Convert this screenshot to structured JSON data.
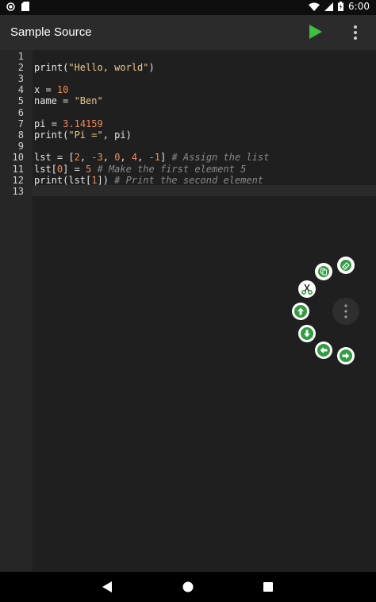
{
  "status": {
    "time": "6:00"
  },
  "app": {
    "title": "Sample Source"
  },
  "editor": {
    "line_numbers": [
      "1",
      "2",
      "3",
      "4",
      "5",
      "6",
      "7",
      "8",
      "9",
      "10",
      "11",
      "12",
      "13"
    ],
    "lines": [
      [],
      [
        {
          "t": "print(",
          "c": ""
        },
        {
          "t": "\"Hello, world\"",
          "c": "str"
        },
        {
          "t": ")",
          "c": ""
        }
      ],
      [],
      [
        {
          "t": "x ",
          "c": ""
        },
        {
          "t": "= ",
          "c": "op"
        },
        {
          "t": "10",
          "c": "num"
        }
      ],
      [
        {
          "t": "name ",
          "c": ""
        },
        {
          "t": "= ",
          "c": "op"
        },
        {
          "t": "\"Ben\"",
          "c": "str"
        }
      ],
      [],
      [
        {
          "t": "pi ",
          "c": ""
        },
        {
          "t": "= ",
          "c": "op"
        },
        {
          "t": "3.14159",
          "c": "num"
        }
      ],
      [
        {
          "t": "print(",
          "c": ""
        },
        {
          "t": "\"Pi =\"",
          "c": "str"
        },
        {
          "t": ", pi)",
          "c": ""
        }
      ],
      [],
      [
        {
          "t": "lst ",
          "c": ""
        },
        {
          "t": "= ",
          "c": "op"
        },
        {
          "t": "[",
          "c": ""
        },
        {
          "t": "2",
          "c": "num"
        },
        {
          "t": ", ",
          "c": ""
        },
        {
          "t": "-3",
          "c": "num"
        },
        {
          "t": ", ",
          "c": ""
        },
        {
          "t": "0",
          "c": "num"
        },
        {
          "t": ", ",
          "c": ""
        },
        {
          "t": "4",
          "c": "num"
        },
        {
          "t": ", ",
          "c": ""
        },
        {
          "t": "-1",
          "c": "num"
        },
        {
          "t": "] ",
          "c": ""
        },
        {
          "t": "# Assign the list",
          "c": "cmt"
        }
      ],
      [
        {
          "t": "lst[",
          "c": ""
        },
        {
          "t": "0",
          "c": "num"
        },
        {
          "t": "] ",
          "c": ""
        },
        {
          "t": "= ",
          "c": "op"
        },
        {
          "t": "5 ",
          "c": "num"
        },
        {
          "t": "# Make the first element 5",
          "c": "cmt"
        }
      ],
      [
        {
          "t": "print(lst[",
          "c": ""
        },
        {
          "t": "1",
          "c": "num"
        },
        {
          "t": "]) ",
          "c": ""
        },
        {
          "t": "# Print the second element",
          "c": "cmt"
        }
      ],
      []
    ]
  },
  "colors": {
    "accent_green": "#2e9e3e",
    "run_green": "#3fbf3f"
  },
  "tools": [
    {
      "name": "paste-tool",
      "icon": "paste-icon"
    },
    {
      "name": "clear-tool",
      "icon": "eraser-icon"
    },
    {
      "name": "cut-tool",
      "icon": "scissors-icon"
    },
    {
      "name": "move-up-tool",
      "icon": "arrow-up-icon"
    },
    {
      "name": "move-down-tool",
      "icon": "arrow-down-icon"
    },
    {
      "name": "move-left-tool",
      "icon": "arrow-left-icon"
    },
    {
      "name": "move-right-tool",
      "icon": "arrow-right-icon"
    },
    {
      "name": "more-tool",
      "icon": "vertical-dots-icon"
    }
  ]
}
